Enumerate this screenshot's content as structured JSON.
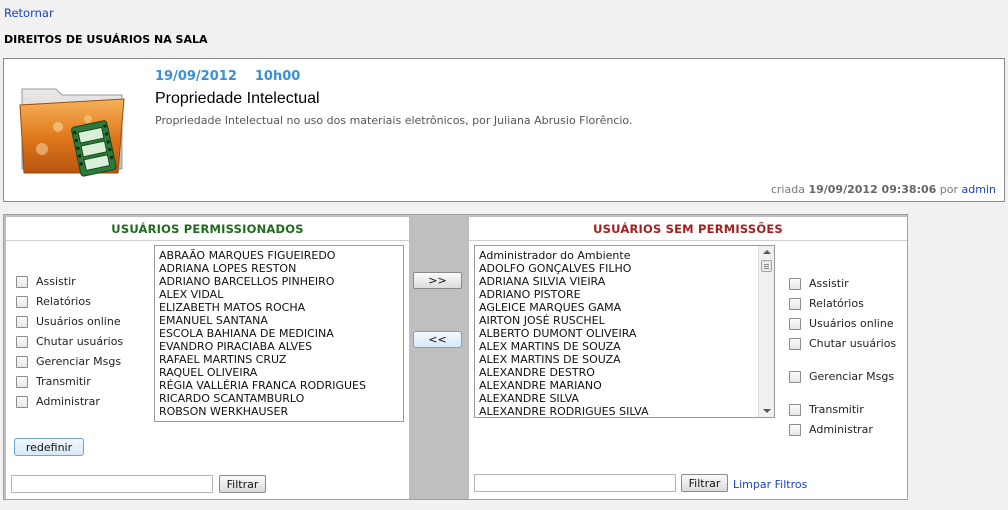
{
  "nav": {
    "back_label": "Retornar"
  },
  "page": {
    "title": "DIREITOS DE USUÁRIOS NA SALA"
  },
  "room": {
    "date": "19/09/2012",
    "time": "10h00",
    "name": "Propriedade Intelectual",
    "description": "Propriedade Intelectual no uso dos materiais eletrônicos, por Juliana Abrusio Florêncio.",
    "created_prefix": "criada",
    "created_at": "19/09/2012 09:38:06",
    "created_by_prefix": "por",
    "created_by": "admin",
    "icon": "folder-video-icon"
  },
  "permitted": {
    "header": "USUÁRIOS PERMISSIONADOS",
    "header_color": "#1f6b1f",
    "permissions": [
      "Assistir",
      "Relatórios",
      "Usuários online",
      "Chutar usuários",
      "Gerenciar Msgs",
      "Transmitir",
      "Administrar"
    ],
    "users": [
      "ABRAÃO MARQUES FIGUEIREDO",
      "ADRIANA LOPES RESTON",
      "ADRIANO BARCELLOS PINHEIRO",
      "ALEX VIDAL",
      "ELIZABETH MATOS ROCHA",
      "EMANUEL SANTANA",
      "ESCOLA BAHIANA DE MEDICINA",
      "EVANDRO PIRACIABA ALVES",
      "RAFAEL MARTINS CRUZ",
      "RAQUEL OLIVEIRA",
      "RÉGIA VALLÉRIA FRANCA RODRIGUES",
      "RICARDO SCANTAMBURLO",
      "ROBSON WERKHAUSER"
    ],
    "reset_label": "redefinir",
    "filter_label": "Filtrar",
    "filter_value": ""
  },
  "transfer": {
    "add_label": ">>",
    "remove_label": "<<"
  },
  "unpermitted": {
    "header": "USUÁRIOS SEM PERMISSÕES",
    "header_color": "#a32020",
    "permissions": [
      "Assistir",
      "Relatórios",
      "Usuários online",
      "Chutar usuários",
      "Gerenciar Msgs",
      "Transmitir",
      "Administrar"
    ],
    "users": [
      "Administrador do Ambiente",
      "ADOLFO GONÇALVES FILHO",
      "ADRIANA SILVIA VIEIRA",
      "ADRIANO PISTORE",
      "AGLEICE MARQUES GAMA",
      "AIRTON JOSÉ RUSCHEL",
      "ALBERTO DUMONT OLIVEIRA",
      "ALEX MARTINS DE SOUZA",
      "ALEX MARTINS DE SOUZA",
      "ALEXANDRE DESTRO",
      "ALEXANDRE MARIANO",
      "ALEXANDRE SILVA",
      "ALEXANDRE RODRIGUES SILVA"
    ],
    "filter_label": "Filtrar",
    "filter_value": "",
    "clear_filters_label": "Limpar Filtros"
  }
}
